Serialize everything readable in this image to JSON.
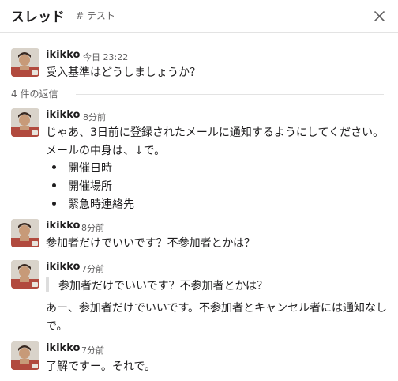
{
  "header": {
    "title": "スレッド",
    "channel": "# テスト",
    "close_icon": "close-icon"
  },
  "parent": {
    "author": "ikikko",
    "time": "今日 23:22",
    "text": "受入基準はどうしましょうか？"
  },
  "replies_divider": "4 件の返信",
  "replies": [
    {
      "author": "ikikko",
      "time": "8分前",
      "lines": [
        "じゃあ、3日前に登録されたメールに通知するようにしてください。",
        "メールの中身は、↓で。"
      ],
      "bullets": [
        "開催日時",
        "開催場所",
        "緊急時連絡先"
      ]
    },
    {
      "author": "ikikko",
      "time": "8分前",
      "lines": [
        "参加者だけでいいです？不参加者とかは？"
      ]
    },
    {
      "author": "ikikko",
      "time": "7分前",
      "quote": "参加者だけでいいです？不参加者とかは？",
      "lines": [
        "あー、参加者だけでいいです。不参加者とキャンセル者には通知なし",
        "で。"
      ]
    },
    {
      "author": "ikikko",
      "time": "7分前",
      "lines": [
        "了解ですー。それで。"
      ]
    }
  ]
}
